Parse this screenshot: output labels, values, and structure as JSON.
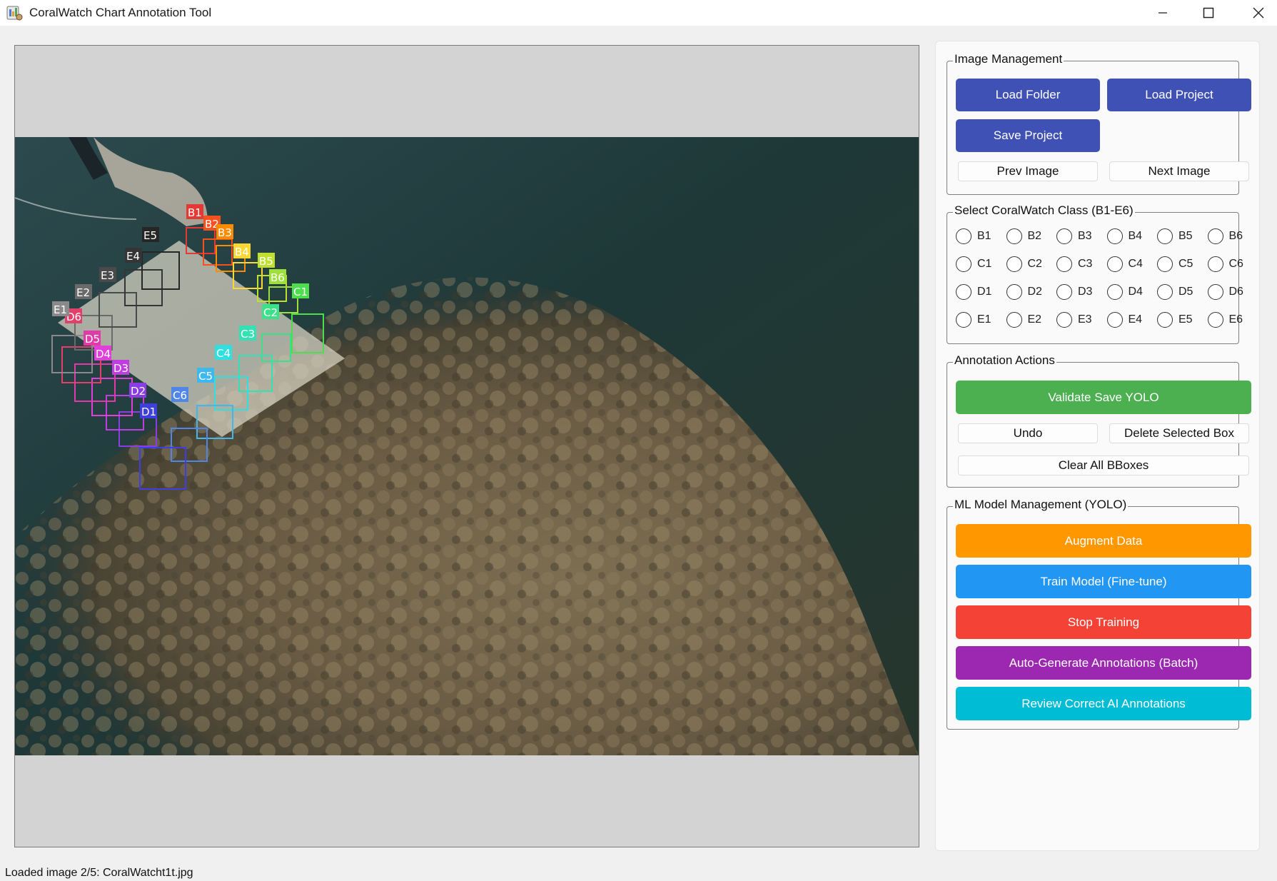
{
  "window": {
    "title": "CoralWatch Chart Annotation Tool",
    "minimize_icon": "minimize-icon",
    "maximize_icon": "maximize-icon",
    "close_icon": "close-icon"
  },
  "image_management": {
    "title": "Image Management",
    "load_folder": "Load Folder",
    "load_project": "Load Project",
    "save_project": "Save Project",
    "prev_image": "Prev Image",
    "next_image": "Next Image"
  },
  "class_select": {
    "title": "Select CoralWatch Class (B1-E6)",
    "options": [
      "B1",
      "B2",
      "B3",
      "B4",
      "B5",
      "B6",
      "C1",
      "C2",
      "C3",
      "C4",
      "C5",
      "C6",
      "D1",
      "D2",
      "D3",
      "D4",
      "D5",
      "D6",
      "E1",
      "E2",
      "E3",
      "E4",
      "E5",
      "E6"
    ],
    "selected": ""
  },
  "annotation_actions": {
    "title": "Annotation Actions",
    "validate_save": "Validate  Save YOLO",
    "undo": "Undo",
    "delete_selected": "Delete Selected Box",
    "clear_all": "Clear All BBoxes"
  },
  "ml_management": {
    "title": "ML Model Management (YOLO)",
    "augment": "Augment Data",
    "train": "Train Model (Fine-tune)",
    "stop": "Stop Training",
    "auto_generate": "Auto-Generate Annotations (Batch)",
    "review": "Review  Correct AI Annotations"
  },
  "colors": {
    "primary_blue": "#3f51b5",
    "green": "#4caf50",
    "orange": "#ff9800",
    "light_blue": "#2196f3",
    "red": "#f44336",
    "purple": "#9c27b0",
    "cyan": "#00bcd4"
  },
  "annotations": [
    {
      "label": "B1",
      "color": "#e53935"
    },
    {
      "label": "B2",
      "color": "#f4511e"
    },
    {
      "label": "B3",
      "color": "#fb8c00"
    },
    {
      "label": "B4",
      "color": "#fdd835"
    },
    {
      "label": "B5",
      "color": "#c0e030"
    },
    {
      "label": "B6",
      "color": "#9ee03a"
    },
    {
      "label": "C1",
      "color": "#4cde4c"
    },
    {
      "label": "C2",
      "color": "#3ddf88"
    },
    {
      "label": "C3",
      "color": "#35e0b5"
    },
    {
      "label": "C4",
      "color": "#30e0e0"
    },
    {
      "label": "C5",
      "color": "#3fb8ee"
    },
    {
      "label": "C6",
      "color": "#4f86e8"
    },
    {
      "label": "D1",
      "color": "#3f3fe0"
    },
    {
      "label": "D2",
      "color": "#8a3de0"
    },
    {
      "label": "D3",
      "color": "#c03ee0"
    },
    {
      "label": "D4",
      "color": "#e040d8"
    },
    {
      "label": "D5",
      "color": "#e03aa8"
    },
    {
      "label": "D6",
      "color": "#e0406a"
    },
    {
      "label": "E1",
      "color": "#8a8a8a"
    },
    {
      "label": "E2",
      "color": "#6a6a6a"
    },
    {
      "label": "E3",
      "color": "#4a4a4a"
    },
    {
      "label": "E4",
      "color": "#353535"
    },
    {
      "label": "E5",
      "color": "#262626"
    }
  ],
  "status": "Loaded image 2/5: CoralWatcht1t.jpg"
}
